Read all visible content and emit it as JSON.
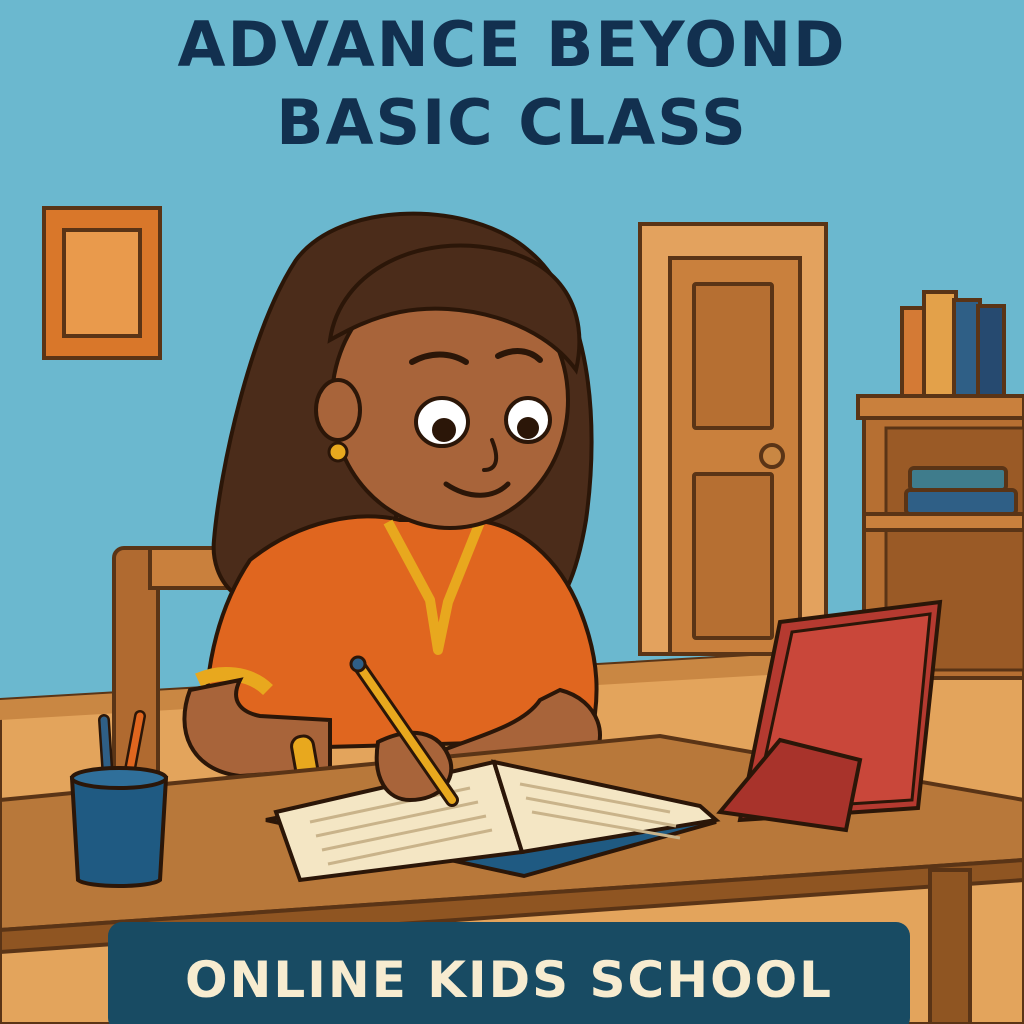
{
  "headline": {
    "line1": "ADVANCE BEYOND",
    "line2": "BASIC CLASS"
  },
  "banner": {
    "label": "ONLINE KIDS SCHOOL"
  },
  "colors": {
    "wall": "#6bb8cf",
    "headline_text": "#12304f",
    "banner_background": "#184b63",
    "banner_text": "#f7ecd0",
    "shirt": "#e0661f",
    "tablet": "#c9473a",
    "desk": "#b8783a"
  }
}
